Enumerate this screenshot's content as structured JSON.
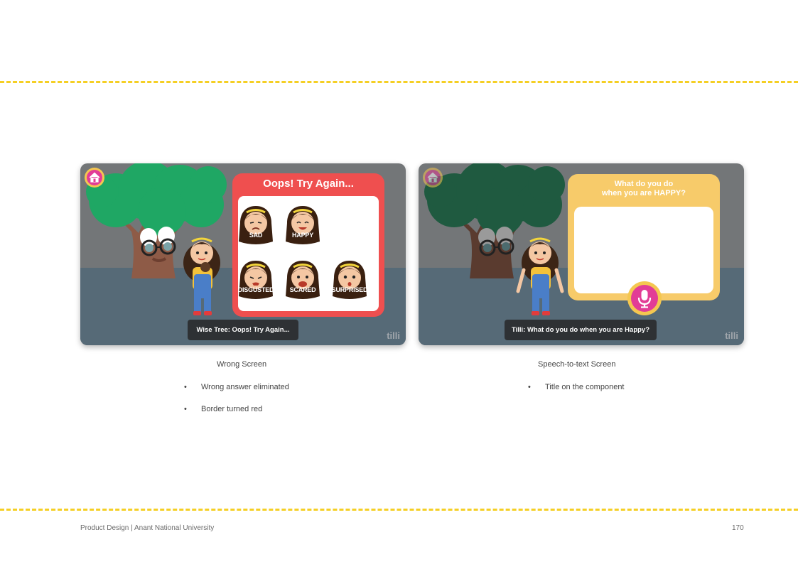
{
  "colors": {
    "divider": "#f5cf24",
    "wrong_panel": "#ef4f4f",
    "speech_panel": "#f7cb6a",
    "mic": "#e23c96",
    "home": "#e23c96"
  },
  "screens": [
    {
      "home_icon": "home-icon",
      "panel_title": "Oops! Try Again...",
      "emotions": [
        "SAD",
        "HAPPY",
        "DISGUSTED",
        "SCARED",
        "SURPRISED"
      ],
      "caption": "Wise Tree: Oops! Try Again...",
      "watermark": "tilli"
    },
    {
      "home_icon": "home-icon",
      "question_line1": "What do you do",
      "question_line2": "when you are HAPPY?",
      "mic_icon": "microphone-icon",
      "caption": "Tilli: What do you do when you are Happy?",
      "watermark": "tilli"
    }
  ],
  "notes": [
    {
      "title": "Wrong Screen",
      "bullets": [
        "Wrong answer eliminated",
        "Border turned red"
      ]
    },
    {
      "title": "Speech-to-text Screen",
      "bullets": [
        "Title on the component"
      ]
    }
  ],
  "footer": {
    "left": "Product Design | Anant National University",
    "page_number": "170"
  }
}
